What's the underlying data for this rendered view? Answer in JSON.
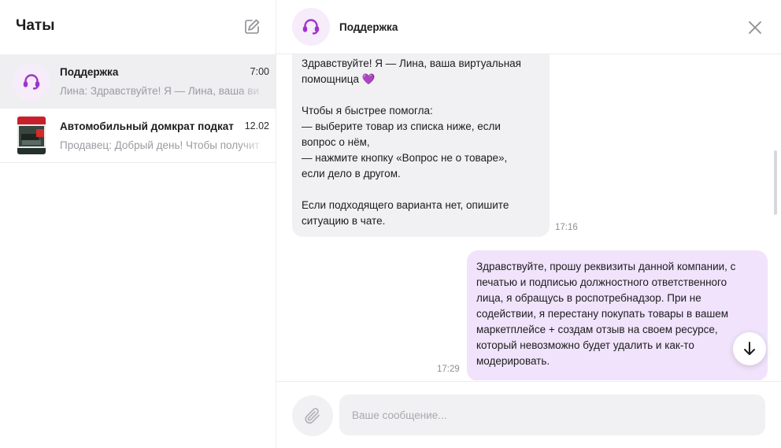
{
  "sidebar": {
    "title": "Чаты",
    "chats": [
      {
        "name": "Поддержка",
        "time": "7:00",
        "preview": "Лина: Здравствуйте! Я — Лина, ваша ви"
      },
      {
        "name": "Автомобильный домкрат подкат",
        "time": "12.02",
        "preview": "Продавец: Добрый день! Чтобы получит"
      }
    ]
  },
  "header": {
    "peer_name": "Поддержка"
  },
  "messages": [
    {
      "direction": "incoming",
      "text": "Здравствуйте! Я — Лина, ваша виртуальная\nпомощница",
      "emoji": "💜",
      "text2": "\nЧтобы я быстрее помогла:\n— выберите товар из списка ниже, если\nвопрос о нём,\n— нажмите кнопку «Вопрос не о товаре»,\nесли дело в другом.\n\nЕсли подходящего варианта нет, опишите\nситуацию в чате.",
      "time": "17:16"
    },
    {
      "direction": "outgoing",
      "text": "Здравствуйте, прошу реквизиты данной компании, с\nпечатью и подписью должностного ответственного\nлица, я обращусь в роспотребнадзор. При не\nсодействии, я перестану покупать товары в вашем\nмаркетплейсе + создам отзыв на своем ресурсе,\nкоторый невозможно будет удалить и как-то\nмодерировать.",
      "time": "17:29"
    }
  ],
  "composer": {
    "placeholder": "Ваше сообщение..."
  },
  "colors": {
    "accent": "#a033cc",
    "outgoing_bubble": "#f0e3fb",
    "incoming_bubble": "#f1f1f4"
  }
}
